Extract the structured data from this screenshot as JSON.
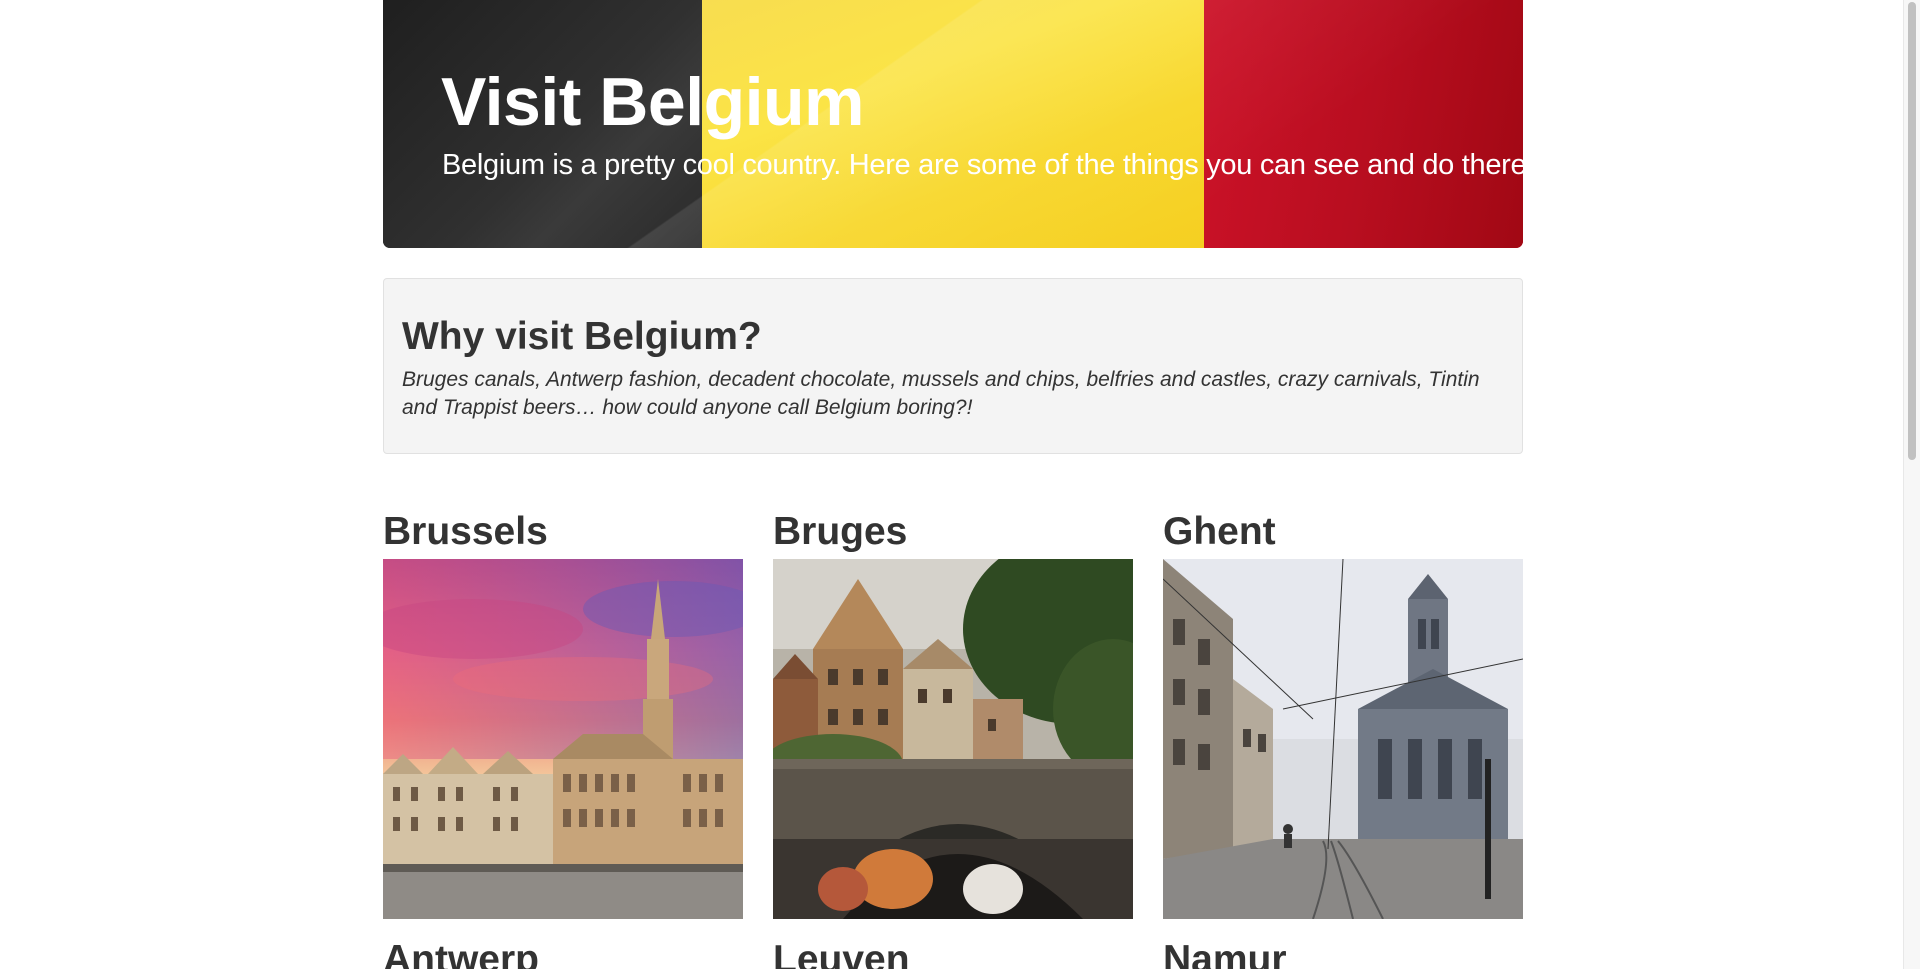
{
  "hero": {
    "title": "Visit Belgium",
    "subtitle": "Belgium is a pretty cool country. Here are some of the things you can see and do there.",
    "flag_colors": [
      "#2c2c2c",
      "#f7d32e",
      "#c30e24"
    ]
  },
  "why": {
    "title": "Why visit Belgium?",
    "text": "Bruges canals, Antwerp fashion, decadent chocolate, mussels and chips, belfries and castles, crazy carnivals, Tintin and Trappist beers… how could anyone call Belgium boring?!"
  },
  "cities": [
    {
      "name": "Brussels",
      "photo": "grand-place-town-hall"
    },
    {
      "name": "Bruges",
      "photo": "canal-bridge"
    },
    {
      "name": "Ghent",
      "photo": "saint-nicholas-church-street"
    },
    {
      "name": "Antwerp"
    },
    {
      "name": "Leuven"
    },
    {
      "name": "Namur"
    }
  ]
}
